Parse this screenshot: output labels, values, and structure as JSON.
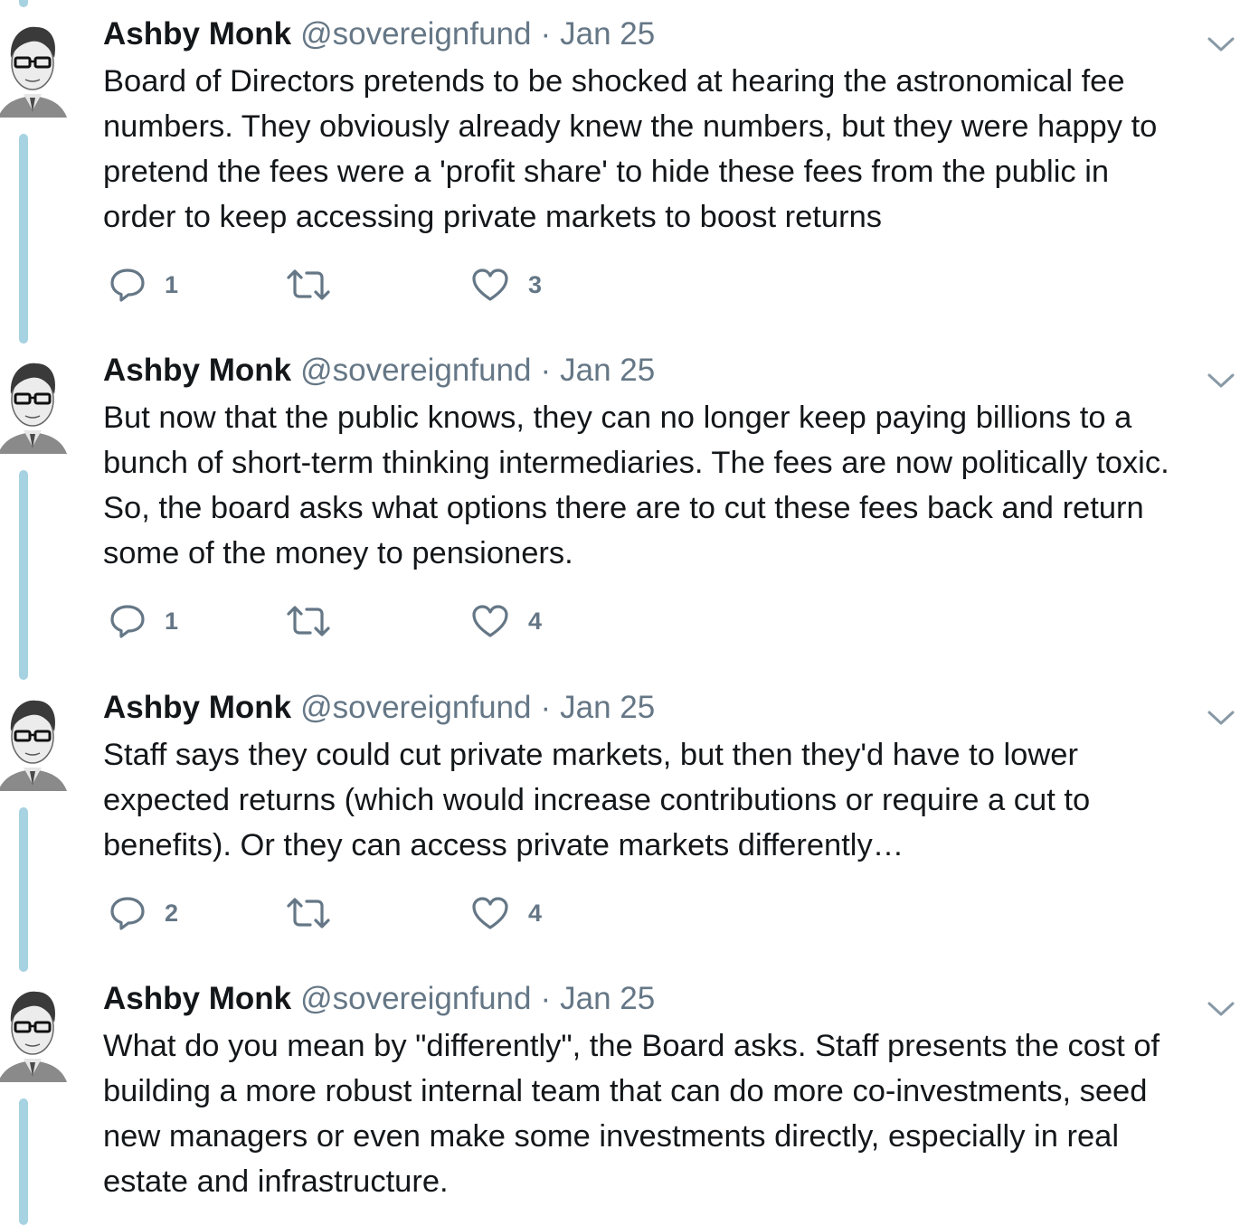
{
  "tweets": [
    {
      "name": "Ashby Monk",
      "handle": "@sovereignfund",
      "separator": "·",
      "date": "Jan 25",
      "text": "Board of Directors pretends to be shocked at hearing the astronomical fee\nnumbers. They obviously already knew the numbers, but they were happy to\npretend the fees were a 'profit share' to hide these fees from the public in\norder to keep accessing private markets to boost returns",
      "replies": "1",
      "retweets": "",
      "likes": "3"
    },
    {
      "name": "Ashby Monk",
      "handle": "@sovereignfund",
      "separator": "·",
      "date": "Jan 25",
      "text": "But now that the public knows, they can no longer keep paying billions to a\nbunch of short-term thinking intermediaries. The fees are now politically toxic.\nSo, the board asks what options there are to cut these fees back and return\nsome of the money to pensioners.",
      "replies": "1",
      "retweets": "",
      "likes": "4"
    },
    {
      "name": "Ashby Monk",
      "handle": "@sovereignfund",
      "separator": "·",
      "date": "Jan 25",
      "text": "Staff says they could cut private markets, but then they'd have to lower\nexpected returns (which would increase contributions or require a cut to\nbenefits). Or they can access private markets differently…",
      "replies": "2",
      "retweets": "",
      "likes": "4"
    },
    {
      "name": "Ashby Monk",
      "handle": "@sovereignfund",
      "separator": "·",
      "date": "Jan 25",
      "text": "What do you mean by \"differently\", the Board asks. Staff presents the cost of\nbuilding a more robust internal team that can do more co-investments, seed\nnew managers or even make some investments directly, especially in real\nestate and infrastructure.",
      "replies": "",
      "retweets": "",
      "likes": ""
    }
  ],
  "icons": {
    "reply": "reply-icon",
    "retweet": "retweet-icon",
    "like": "heart-icon",
    "caret": "chevron-down-icon",
    "avatar": "avatar"
  },
  "colors": {
    "text": "#14171a",
    "secondary": "#657786",
    "thread_line": "#a6d2e1"
  }
}
